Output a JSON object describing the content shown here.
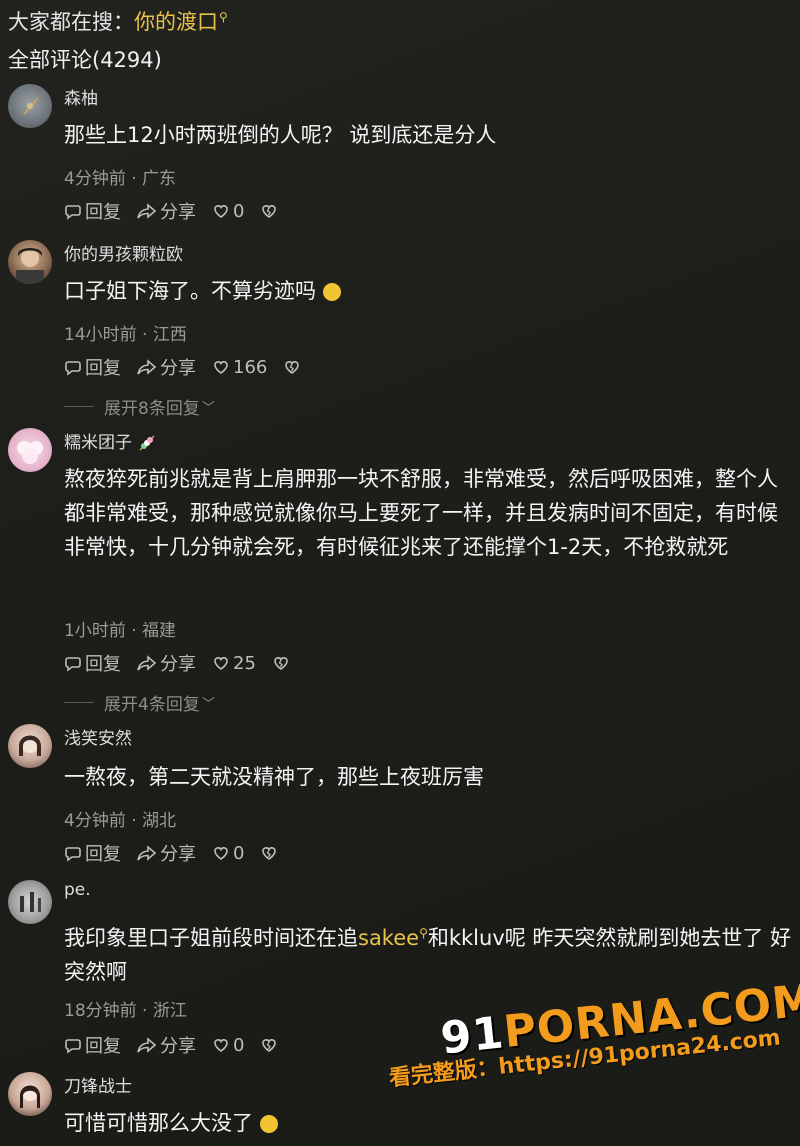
{
  "header": {
    "search_prefix": "大家都在搜：",
    "search_keyword": "你的渡口",
    "comments_title": "全部评论(4294)"
  },
  "actions": {
    "reply": "回复",
    "share": "分享"
  },
  "comments": [
    {
      "username": "森柚",
      "content": "那些上12小时两班倒的人呢？ 说到底还是分人",
      "meta": "4分钟前 · 广东",
      "likes": "0"
    },
    {
      "username": "你的男孩颗粒欧",
      "content": "口子姐下海了。不算劣迹吗",
      "meta": "14小时前 · 江西",
      "likes": "166",
      "expand": "展开8条回复"
    },
    {
      "username": "糯米团子",
      "content": "熬夜猝死前兆就是背上肩胛那一块不舒服，非常难受，然后呼吸困难，整个人都非常难受，那种感觉就像你马上要死了一样，并且发病时间不固定，有时候非常快，十几分钟就会死，有时候征兆来了还能撑个1-2天，不抢救就死",
      "meta": "1小时前 · 福建",
      "likes": "25",
      "expand": "展开4条回复"
    },
    {
      "username": "浅笑安然",
      "content": "一熬夜，第二天就没精神了，那些上夜班厉害",
      "meta": "4分钟前 · 湖北",
      "likes": "0"
    },
    {
      "username": "pe.",
      "content_before": "我印象里口子姐前段时间还在追",
      "content_keyword": "sakee",
      "content_after": "和kkluv呢 昨天突然就刷到她去世了 好突然啊",
      "meta": "18分钟前 · 浙江",
      "likes": "0"
    },
    {
      "username": "刀锋战士",
      "content": "可惜可惜那么大没了"
    }
  ],
  "watermark": {
    "logo_prefix": "91",
    "logo_main": "PORNA.COM",
    "url_text": "看完整版：https://91porna24.com"
  },
  "colors": {
    "keyword": "#e8c24a",
    "watermark": "#f39b1c",
    "background": "#1e1f1b"
  }
}
